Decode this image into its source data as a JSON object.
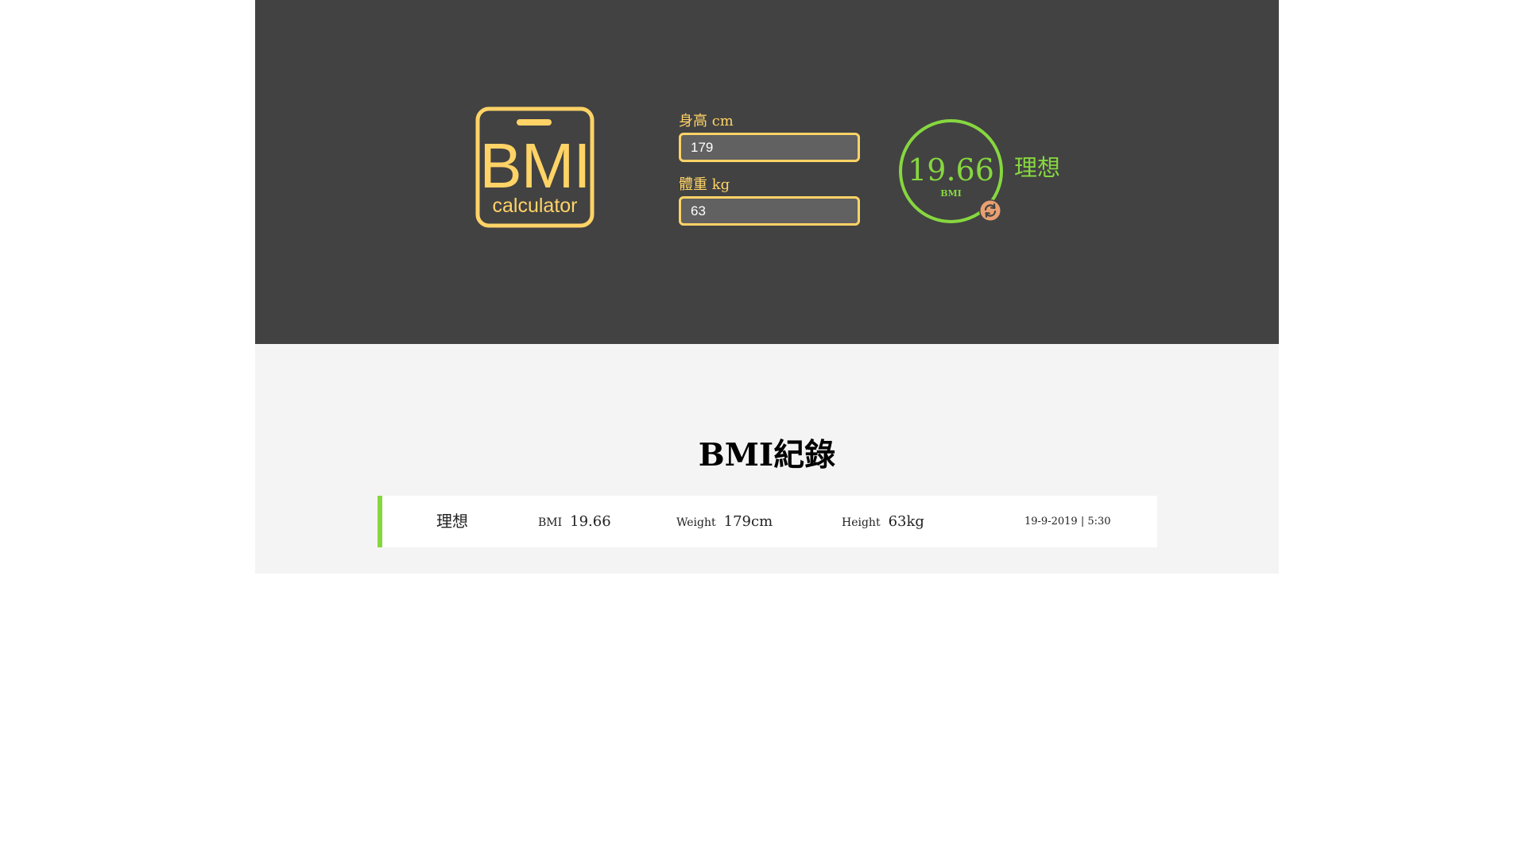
{
  "app": {
    "logo_title": "BMI",
    "logo_subtitle": "calculator"
  },
  "form": {
    "height_label": "身高 cm",
    "height_value": "179",
    "weight_label": "體重 kg",
    "weight_value": "63"
  },
  "result": {
    "bmi_value": "19.66",
    "bmi_unit": "BMI",
    "status": "理想",
    "reset_icon": "refresh-icon"
  },
  "records": {
    "title": "BMI紀錄",
    "items": [
      {
        "status": "理想",
        "bmi_label": "BMI",
        "bmi_value": "19.66",
        "weight_label": "Weight",
        "weight_value": "179cm",
        "height_label": "Height",
        "height_value": "63kg",
        "timestamp": "19-9-2019 | 5:30"
      }
    ]
  },
  "colors": {
    "hero_bg": "#424242",
    "accent_yellow": "#ffd366",
    "status_green": "#86d73f",
    "records_bg": "#f4f4f4",
    "reset_orange": "#e9a071"
  }
}
